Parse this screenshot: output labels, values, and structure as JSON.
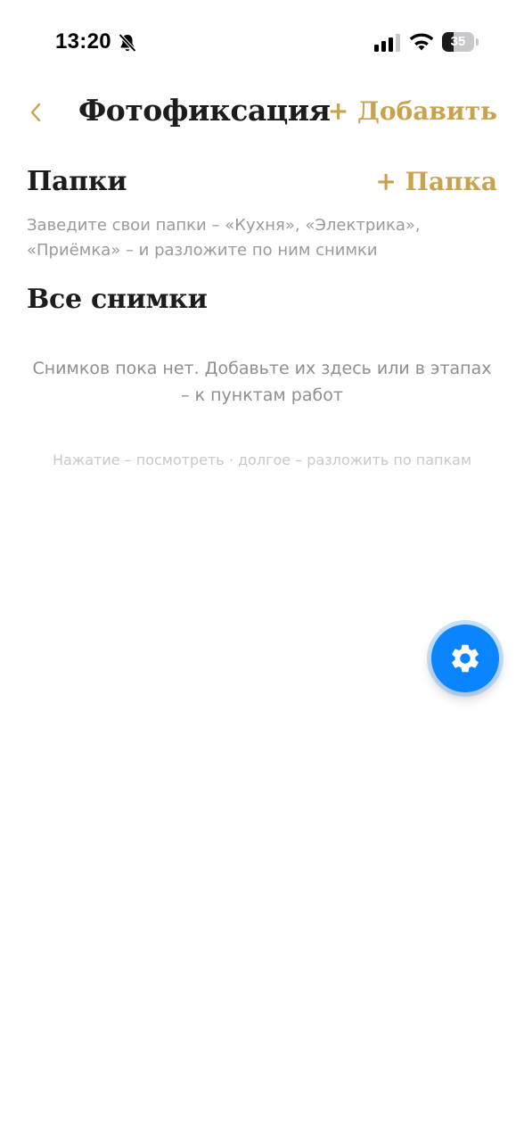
{
  "status_bar": {
    "time": "13:20",
    "battery_level": "35",
    "battery_fraction": 0.35
  },
  "nav": {
    "title": "Фотофиксация",
    "add_label": "+ Добавить"
  },
  "folders": {
    "title": "Папки",
    "add_label": "+ Папка",
    "hint": "Заведите свои папки – «Кухня», «Электрика», «Приёмка» – и разложите по ним снимки"
  },
  "photos": {
    "title": "Все снимки",
    "empty_text": "Снимков пока нет. Добавьте их здесь или в этапах – к пунктам работ",
    "gesture_hint": "Нажатие – посмотреть · долгое – разложить по папкам"
  },
  "icons": {
    "back": "chevron-left-icon",
    "settings": "gear-icon",
    "status": [
      "bell-slash-icon",
      "signal-icon",
      "wifi-icon",
      "battery-icon"
    ]
  },
  "colors": {
    "accent_gold": "#c9a24e",
    "fab_blue": "#0a84ff",
    "text_primary": "#1c1c1e",
    "text_secondary": "#9a9a9e",
    "text_hint": "#c7c7cc"
  }
}
